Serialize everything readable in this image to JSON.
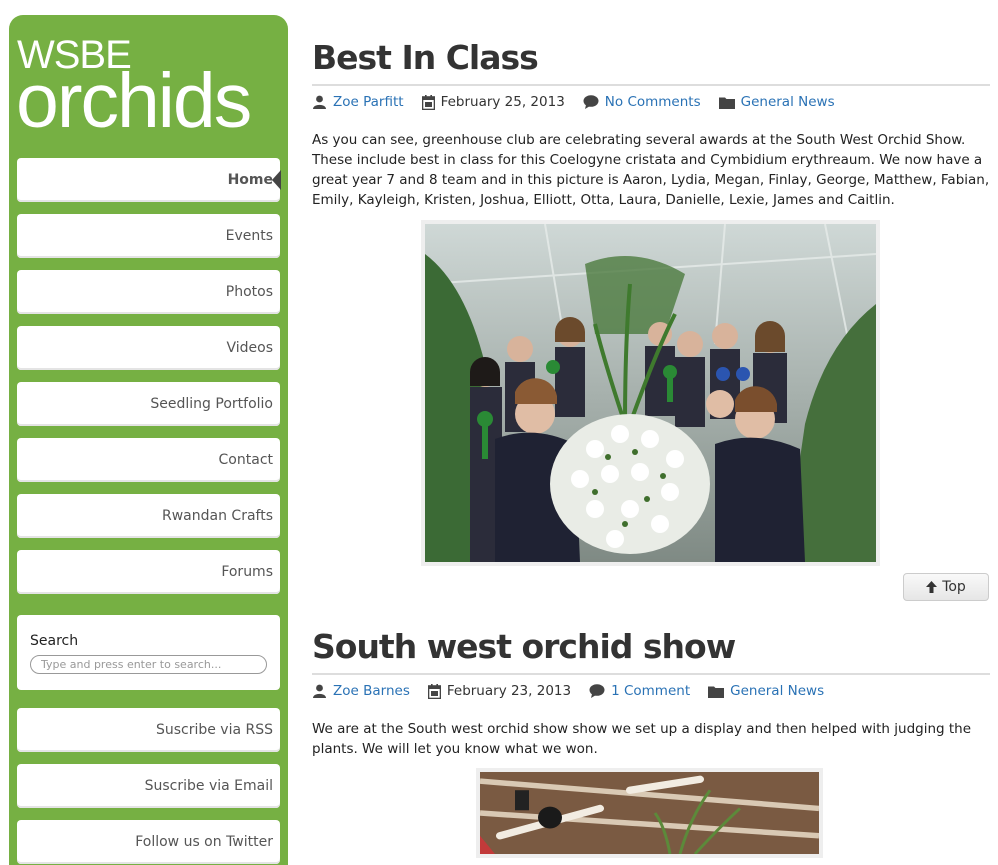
{
  "site": {
    "logo_line1": "WSBE",
    "logo_line2": "orchids"
  },
  "nav": {
    "items": [
      {
        "label": "Home",
        "active": true
      },
      {
        "label": "Events"
      },
      {
        "label": "Photos"
      },
      {
        "label": "Videos"
      },
      {
        "label": "Seedling Portfolio"
      },
      {
        "label": "Contact"
      },
      {
        "label": "Rwandan Crafts"
      },
      {
        "label": "Forums"
      }
    ]
  },
  "search": {
    "label": "Search",
    "placeholder": "Type and press enter to search..."
  },
  "subscribe": {
    "items": [
      {
        "label": "Suscribe via RSS"
      },
      {
        "label": "Suscribe via Email"
      },
      {
        "label": "Follow us on Twitter"
      }
    ]
  },
  "posts": [
    {
      "title": "Best In Class",
      "author": "Zoe Parfitt",
      "date": "February 25, 2013",
      "comments": "No Comments",
      "category": "General News",
      "body": "As you can see, greenhouse club are celebrating several awards at the South West Orchid Show. These include best in class for this Coelogyne cristata and Cymbidium erythreaum. We now have a great year 7 and 8 team and in this picture is Aaron, Lydia, Megan, Finlay, George, Matthew, Fabian, Emily, Kayleigh, Kristen, Joshua, Elliott, Otta, Laura, Danielle, Lexie, James and Caitlin."
    },
    {
      "title": "South west orchid show",
      "author": "Zoe Barnes",
      "date": "February 23, 2013",
      "comments": "1 Comment",
      "category": "General News",
      "body": "We are at the South west orchid show show we set up a display and then helped with judging the plants. We will let you know what we won."
    }
  ],
  "top_button": {
    "label": "Top"
  },
  "colors": {
    "sidebar_green": "#76b043",
    "link_blue": "#2a72b5"
  },
  "icons": [
    "user-icon",
    "calendar-icon",
    "comment-icon",
    "folder-icon",
    "arrow-up-icon"
  ]
}
